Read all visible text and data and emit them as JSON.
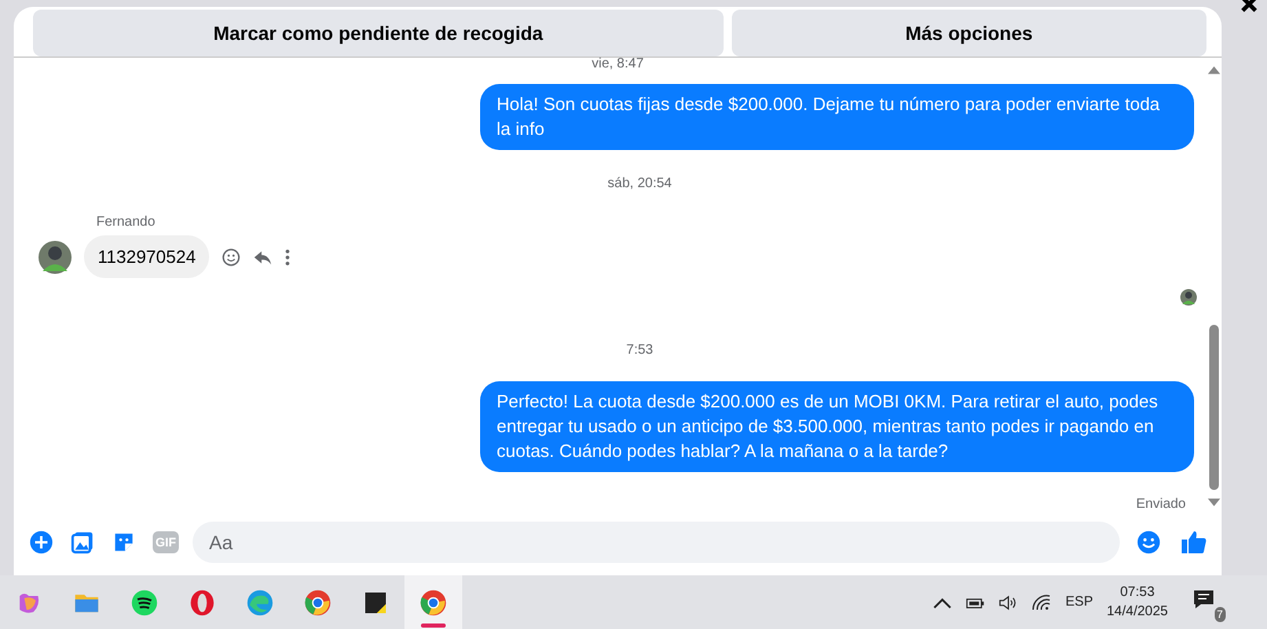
{
  "header_buttons": [
    "Marcar como pendiente de recogida",
    "Más opciones"
  ],
  "messages": [
    {
      "kind": "time",
      "text": "vie, 8:47"
    },
    {
      "kind": "outgoing",
      "text": "Hola! Son cuotas fijas desde $200.000. Dejame tu número para poder enviarte toda la info"
    },
    {
      "kind": "time",
      "text": "sáb, 20:54"
    },
    {
      "kind": "incoming",
      "sender": "Fernando",
      "text": "1132970524"
    },
    {
      "kind": "seen"
    },
    {
      "kind": "time",
      "text": "7:53"
    },
    {
      "kind": "outgoing",
      "text": "Perfecto! La cuota desde $200.000 es de un MOBI 0KM. Para retirar el auto, podes entregar tu usado o un anticipo de $3.500.000, mientras tanto podes ir pagando en cuotas. Cuándo podes hablar? A la mañana o a la tarde?"
    },
    {
      "kind": "status",
      "text": "Enviado"
    }
  ],
  "composer": {
    "gif": "GIF",
    "placeholder": "Aa"
  },
  "taskbar": {
    "apps": [
      {
        "kind": "copilot",
        "selected": false
      },
      {
        "kind": "folder",
        "selected": false
      },
      {
        "kind": "spotify",
        "selected": false
      },
      {
        "kind": "opera",
        "selected": false
      },
      {
        "kind": "edge",
        "selected": false
      },
      {
        "kind": "chrome",
        "selected": false
      },
      {
        "kind": "notes",
        "selected": false
      },
      {
        "kind": "chrome",
        "selected": true
      }
    ],
    "language": "ESP",
    "time": "07:53",
    "date": "14/4/2025",
    "notifications": "7"
  }
}
